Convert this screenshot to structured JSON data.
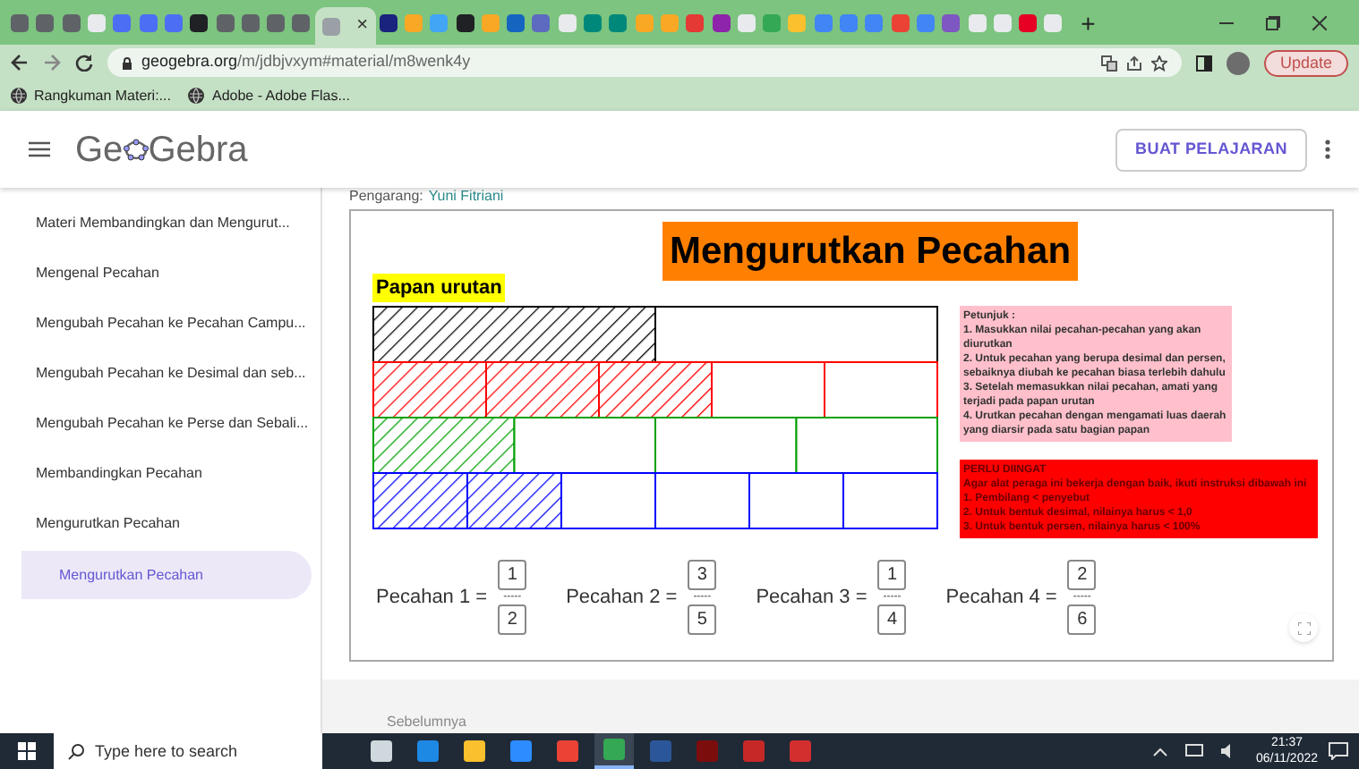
{
  "browser": {
    "tabs": [
      {
        "color": "#5f6368",
        "selected": false
      },
      {
        "color": "#5f6368",
        "selected": false
      },
      {
        "color": "#5f6368",
        "selected": false
      },
      {
        "color": "#e8eaed",
        "selected": false
      },
      {
        "color": "#4c6ef5",
        "selected": false
      },
      {
        "color": "#4c6ef5",
        "selected": false
      },
      {
        "color": "#4c6ef5",
        "selected": false
      },
      {
        "color": "#202124",
        "selected": false
      },
      {
        "color": "#5f6368",
        "selected": false
      },
      {
        "color": "#5f6368",
        "selected": false
      },
      {
        "color": "#5f6368",
        "selected": false
      },
      {
        "color": "#5f6368",
        "selected": false
      },
      {
        "color": "#9aa0a6",
        "selected": true
      },
      {
        "color": "#1a237e",
        "selected": false
      },
      {
        "color": "#f9a825",
        "selected": false
      },
      {
        "color": "#42a5f5",
        "selected": false
      },
      {
        "color": "#202124",
        "selected": false
      },
      {
        "color": "#f9a825",
        "selected": false
      },
      {
        "color": "#1565c0",
        "selected": false
      },
      {
        "color": "#5c6bc0",
        "selected": false
      },
      {
        "color": "#e8eaed",
        "selected": false
      },
      {
        "color": "#00897b",
        "selected": false
      },
      {
        "color": "#00897b",
        "selected": false
      },
      {
        "color": "#f9a825",
        "selected": false
      },
      {
        "color": "#f9a825",
        "selected": false
      },
      {
        "color": "#e53935",
        "selected": false
      },
      {
        "color": "#8e24aa",
        "selected": false
      },
      {
        "color": "#e8eaed",
        "selected": false
      },
      {
        "color": "#34a853",
        "selected": false
      },
      {
        "color": "#fbc02d",
        "selected": false
      },
      {
        "color": "#4285f4",
        "selected": false
      },
      {
        "color": "#4285f4",
        "selected": false
      },
      {
        "color": "#4285f4",
        "selected": false
      },
      {
        "color": "#ea4335",
        "selected": false
      },
      {
        "color": "#4285f4",
        "selected": false
      },
      {
        "color": "#7e57c2",
        "selected": false
      },
      {
        "color": "#e8eaed",
        "selected": false
      },
      {
        "color": "#e8eaed",
        "selected": false
      },
      {
        "color": "#e60023",
        "selected": false
      },
      {
        "color": "#e8eaed",
        "selected": false
      }
    ],
    "close_tab": "×",
    "new_tab": "+",
    "url_host": "geogebra.org",
    "url_path": "/m/jdbjvxym#material/m8wenk4y",
    "update_button": "Update",
    "bookmarks": [
      "Rangkuman Materi:...",
      "Adobe - Adobe Flas..."
    ]
  },
  "header": {
    "logo_left": "Ge",
    "logo_right": "Gebra",
    "button": "BUAT PELAJARAN"
  },
  "sidebar": {
    "items": [
      {
        "label": "Materi Membandingkan dan Mengurut...",
        "selected": false
      },
      {
        "label": "Mengenal Pecahan",
        "selected": false
      },
      {
        "label": "Mengubah Pecahan ke Pecahan Campu...",
        "selected": false
      },
      {
        "label": "Mengubah Pecahan ke Desimal dan seb...",
        "selected": false
      },
      {
        "label": "Mengubah Pecahan ke Perse dan Sebali...",
        "selected": false
      },
      {
        "label": "Membandingkan Pecahan",
        "selected": false
      },
      {
        "label": "Mengurutkan Pecahan",
        "selected": false
      },
      {
        "label": "Mengurutkan Pecahan",
        "selected": true
      }
    ]
  },
  "author": {
    "label": "Pengarang:",
    "name": "Yuni Fitriani"
  },
  "applet": {
    "title": "Mengurutkan Pecahan",
    "board_label": "Papan urutan",
    "fractions": [
      {
        "label": "Pecahan 1 =",
        "numerator": "1",
        "separator": "-----",
        "denominator": "2"
      },
      {
        "label": "Pecahan 2 =",
        "numerator": "3",
        "separator": "-----",
        "denominator": "5"
      },
      {
        "label": "Pecahan 3 =",
        "numerator": "1",
        "separator": "-----",
        "denominator": "4"
      },
      {
        "label": "Pecahan 4 =",
        "numerator": "2",
        "separator": "-----",
        "denominator": "6"
      }
    ],
    "board_bars": [
      {
        "color": "#000000"
      },
      {
        "color": "#ff0000"
      },
      {
        "color": "#00a000"
      },
      {
        "color": "#0000ff"
      }
    ],
    "instructions": {
      "heading": "Petunjuk :",
      "lines": [
        "1. Masukkan nilai pecahan-pecahan yang akan diurutkan",
        "2. Untuk pecahan yang berupa desimal dan persen, sebaiknya diubah ke pecahan biasa terlebih dahulu",
        "3. Setelah memasukkan nilai pecahan, amati yang terjadi pada papan urutan",
        "4. Urutkan pecahan dengan mengamati luas daerah yang diarsir pada satu bagian papan"
      ]
    },
    "warning": {
      "heading": "PERLU DIINGAT",
      "lines": [
        "Agar alat peraga ini bekerja dengan baik, ikuti instruksi dibawah ini",
        "1. Pembilang < penyebut",
        "2. Untuk bentuk desimal, nilainya harus < 1,0",
        "3. Untuk bentuk persen, nilainya harus < 100%"
      ]
    }
  },
  "previous_link": "Sebelumnya",
  "taskbar": {
    "search_placeholder": "Type here to search",
    "apps": [
      {
        "color": "#cfd8dc",
        "selected": false
      },
      {
        "color": "#1e88e5",
        "selected": false
      },
      {
        "color": "#fbc02d",
        "selected": false
      },
      {
        "color": "#2d8cff",
        "selected": false
      },
      {
        "color": "#ea4335",
        "selected": false
      },
      {
        "color": "#34a853",
        "selected": true
      },
      {
        "color": "#2b579a",
        "selected": false
      },
      {
        "color": "#7b0d0d",
        "selected": false
      },
      {
        "color": "#c62828",
        "selected": false
      },
      {
        "color": "#d32f2f",
        "selected": false
      }
    ],
    "time": "21:37",
    "date": "06/11/2022"
  }
}
